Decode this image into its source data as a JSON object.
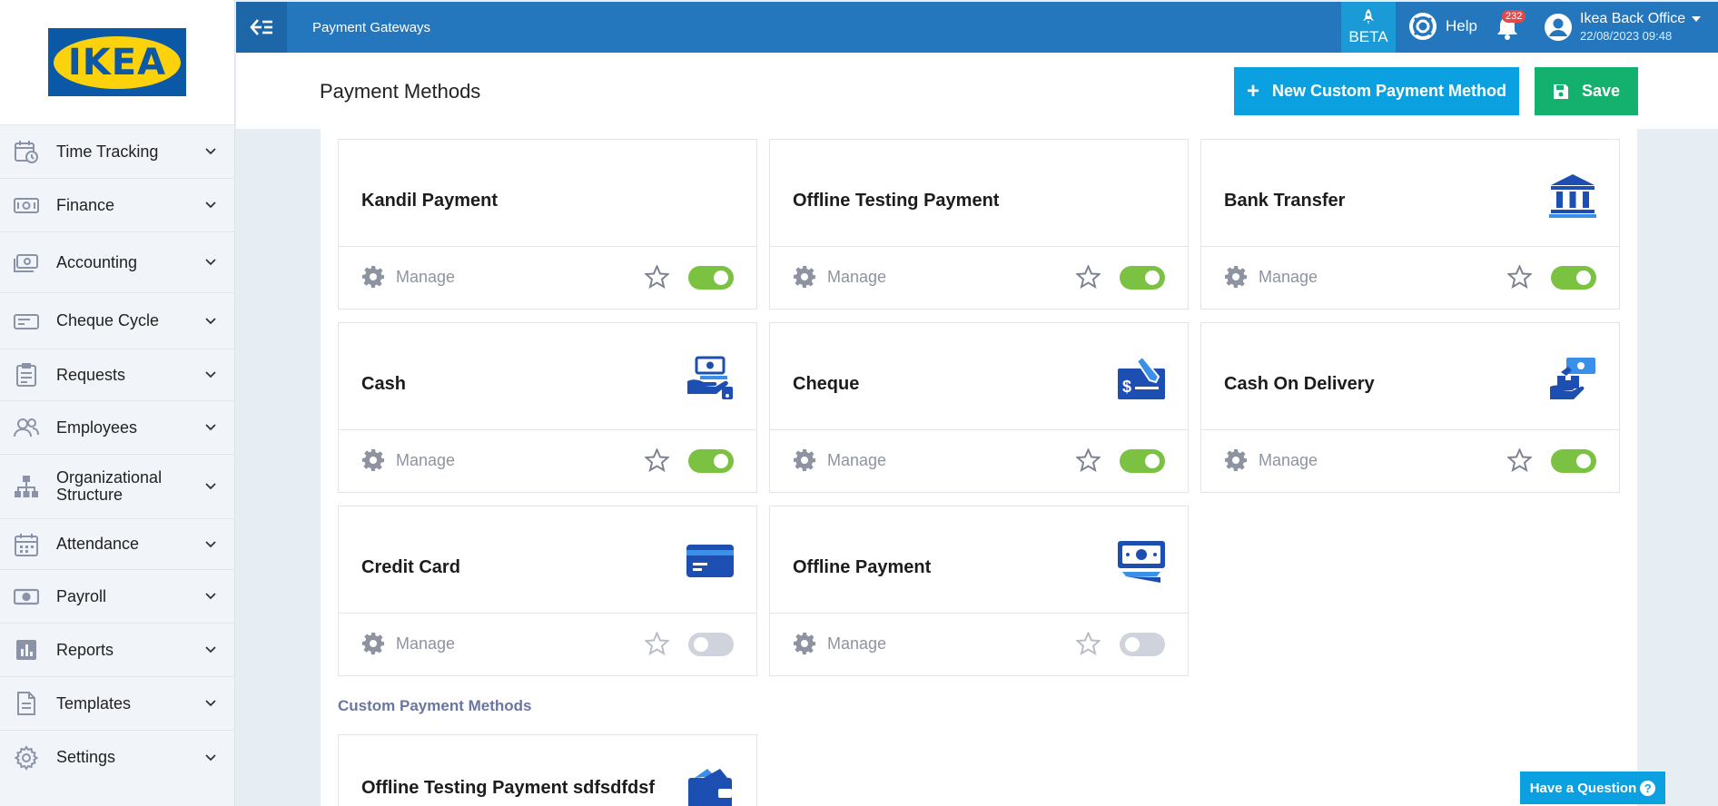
{
  "brand": {
    "logo_text": "IKEA"
  },
  "topbar": {
    "title": "Payment Gateways",
    "beta_label": "BETA",
    "help_label": "Help",
    "notification_count": "232",
    "user_name": "Ikea Back Office",
    "user_datetime": "22/08/2023 09:48"
  },
  "sidebar": {
    "items": [
      {
        "label": "Time Tracking",
        "icon": "time-tracking-icon"
      },
      {
        "label": "Finance",
        "icon": "finance-icon"
      },
      {
        "label": "Accounting",
        "icon": "accounting-icon"
      },
      {
        "label": "Cheque Cycle",
        "icon": "cheque-cycle-icon"
      },
      {
        "label": "Requests",
        "icon": "requests-icon"
      },
      {
        "label": "Employees",
        "icon": "employees-icon"
      },
      {
        "label": "Organizational Structure",
        "icon": "org-structure-icon"
      },
      {
        "label": "Attendance",
        "icon": "attendance-icon"
      },
      {
        "label": "Payroll",
        "icon": "payroll-icon"
      },
      {
        "label": "Reports",
        "icon": "reports-icon"
      },
      {
        "label": "Templates",
        "icon": "templates-icon"
      },
      {
        "label": "Settings",
        "icon": "settings-icon"
      }
    ]
  },
  "header": {
    "page_title": "Payment Methods",
    "new_button_label": "New Custom Payment Method",
    "save_button_label": "Save"
  },
  "cards": {
    "manage_label": "Manage",
    "items": [
      {
        "name": "Kandil Payment",
        "icon": "",
        "enabled": true
      },
      {
        "name": "Offline Testing Payment",
        "icon": "",
        "enabled": true
      },
      {
        "name": "Bank Transfer",
        "icon": "bank-icon",
        "enabled": true
      },
      {
        "name": "Cash",
        "icon": "cash-hand-icon",
        "enabled": true
      },
      {
        "name": "Cheque",
        "icon": "cheque-icon",
        "enabled": true
      },
      {
        "name": "Cash On Delivery",
        "icon": "cash-on-delivery-icon",
        "enabled": true
      },
      {
        "name": "Credit Card",
        "icon": "credit-card-icon",
        "enabled": false
      },
      {
        "name": "Offline Payment",
        "icon": "offline-payment-icon",
        "enabled": false
      }
    ]
  },
  "custom": {
    "section_title": "Custom Payment Methods",
    "items": [
      {
        "name": "Offline Testing Payment sdfsdfdsf",
        "icon": "wallet-icon"
      }
    ]
  },
  "support": {
    "question_label": "Have a Question"
  },
  "colors": {
    "primary": "#2577bd",
    "accent": "#0ba1e1",
    "success": "#14b06e",
    "toggle_on": "#7cc242",
    "icon_blue": "#1d4fb3"
  }
}
